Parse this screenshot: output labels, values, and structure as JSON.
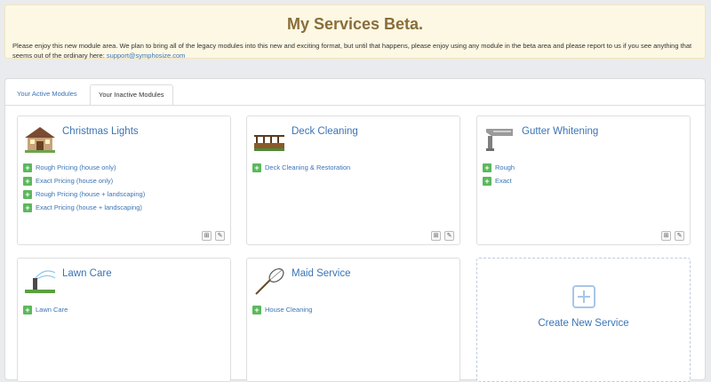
{
  "banner": {
    "title": "My Services Beta.",
    "text": "Please enjoy this new module area. We plan to bring all of the legacy modules into this new and exciting format, but until that happens, please enjoy using any module in the beta area and please report to us if you see anything that seems out of the ordinary here:",
    "link": "support@symphosize.com"
  },
  "tabs": [
    {
      "label": "Your Active Modules",
      "active": false
    },
    {
      "label": "Your Inactive Modules",
      "active": true
    }
  ],
  "services": [
    {
      "title": "Christmas Lights",
      "icon": "house-icon",
      "options": [
        "Rough Pricing (house only)",
        "Exact Pricing (house only)",
        "Rough Pricing (house + landscaping)",
        "Exact Pricing (house + landscaping)"
      ]
    },
    {
      "title": "Deck Cleaning",
      "icon": "deck-icon",
      "options": [
        "Deck Cleaning & Restoration"
      ]
    },
    {
      "title": "Gutter Whitening",
      "icon": "gutter-icon",
      "options": [
        "Rough",
        "Exact"
      ]
    },
    {
      "title": "Lawn Care",
      "icon": "sprinkler-icon",
      "options": [
        "Lawn Care"
      ]
    },
    {
      "title": "Maid Service",
      "icon": "feather-duster-icon",
      "options": [
        "House Cleaning"
      ]
    }
  ],
  "create": {
    "label": "Create New Service"
  },
  "colors": {
    "accent": "#3b74b5",
    "add": "#5cb85c",
    "banner_bg": "#fcf8e3",
    "banner_title": "#8a6d3b"
  }
}
